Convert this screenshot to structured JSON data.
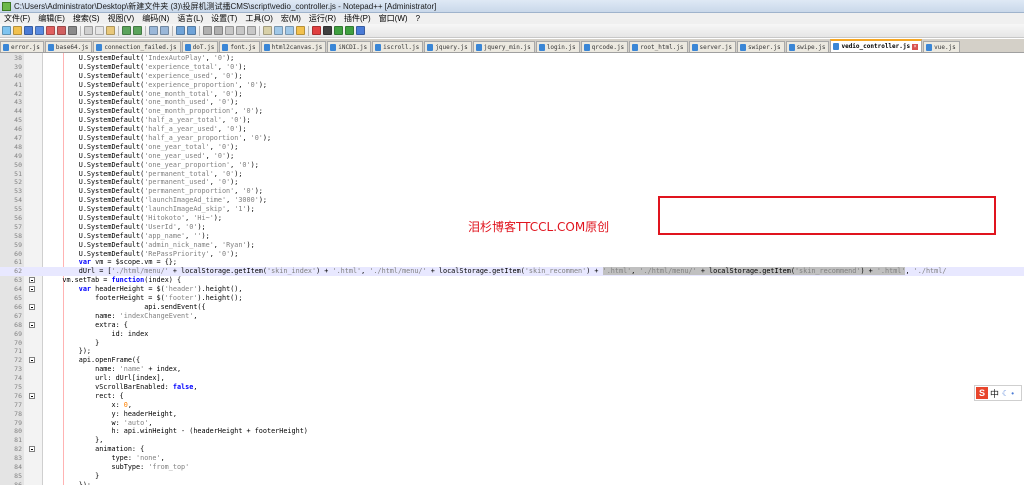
{
  "window": {
    "title": "C:\\Users\\Administrator\\Desktop\\新建文件夹 (3)\\投屏机测试播CMS\\script\\vedio_controller.js - Notepad++ [Administrator]"
  },
  "menu": [
    "文件(F)",
    "编辑(E)",
    "搜索(S)",
    "视图(V)",
    "编码(N)",
    "语言(L)",
    "设置(T)",
    "工具(O)",
    "宏(M)",
    "运行(R)",
    "插件(P)",
    "窗口(W)",
    "?"
  ],
  "tabs": [
    {
      "label": "error.js"
    },
    {
      "label": "base64.js"
    },
    {
      "label": "connection_failed.js"
    },
    {
      "label": "doT.js"
    },
    {
      "label": "font.js"
    },
    {
      "label": "html2canvas.js"
    },
    {
      "label": "iNCDI.js"
    },
    {
      "label": "iscroll.js"
    },
    {
      "label": "jquery.js"
    },
    {
      "label": "jquery_min.js"
    },
    {
      "label": "login.js"
    },
    {
      "label": "qrcode.js"
    },
    {
      "label": "root_html.js"
    },
    {
      "label": "server.js"
    },
    {
      "label": "swiper.js"
    },
    {
      "label": "swipe.js"
    },
    {
      "label": "vedio_controller.js",
      "active": true
    },
    {
      "label": "vue.js"
    }
  ],
  "watermark": "泪杉博客TTCCL.COM原创",
  "ime": {
    "logo": "S",
    "mode": "中",
    "moon": "☾",
    "dot": "•"
  },
  "colors": {
    "keyword": "#0000ff",
    "string": "#808080",
    "number": "#ff8000",
    "annotation": "#e0141e",
    "current_line": "#e8e8ff"
  },
  "code_lines": [
    {
      "n": 38,
      "html": "        U.SystemDefault(<span class=\"str\">'IndexAutoPlay'</span>, <span class=\"str\">'0'</span>);"
    },
    {
      "n": 39,
      "html": "        U.SystemDefault(<span class=\"str\">'experience_total'</span>, <span class=\"str\">'0'</span>);"
    },
    {
      "n": 40,
      "html": "        U.SystemDefault(<span class=\"str\">'experience_used'</span>, <span class=\"str\">'0'</span>);"
    },
    {
      "n": 41,
      "html": "        U.SystemDefault(<span class=\"str\">'experience_proportion'</span>, <span class=\"str\">'0'</span>);"
    },
    {
      "n": 42,
      "html": "        U.SystemDefault(<span class=\"str\">'one_month_total'</span>, <span class=\"str\">'0'</span>);"
    },
    {
      "n": 43,
      "html": "        U.SystemDefault(<span class=\"str\">'one_month_used'</span>, <span class=\"str\">'0'</span>);"
    },
    {
      "n": 44,
      "html": "        U.SystemDefault(<span class=\"str\">'one_month_proportion'</span>, <span class=\"str\">'0'</span>);"
    },
    {
      "n": 45,
      "html": "        U.SystemDefault(<span class=\"str\">'half_a_year_total'</span>, <span class=\"str\">'0'</span>);"
    },
    {
      "n": 46,
      "html": "        U.SystemDefault(<span class=\"str\">'half_a_year_used'</span>, <span class=\"str\">'0'</span>);"
    },
    {
      "n": 47,
      "html": "        U.SystemDefault(<span class=\"str\">'half_a_year_proportion'</span>, <span class=\"str\">'0'</span>);"
    },
    {
      "n": 48,
      "html": "        U.SystemDefault(<span class=\"str\">'one_year_total'</span>, <span class=\"str\">'0'</span>);"
    },
    {
      "n": 49,
      "html": "        U.SystemDefault(<span class=\"str\">'one_year_used'</span>, <span class=\"str\">'0'</span>);"
    },
    {
      "n": 50,
      "html": "        U.SystemDefault(<span class=\"str\">'one_year_proportion'</span>, <span class=\"str\">'0'</span>);"
    },
    {
      "n": 51,
      "html": "        U.SystemDefault(<span class=\"str\">'permanent_total'</span>, <span class=\"str\">'0'</span>);"
    },
    {
      "n": 52,
      "html": "        U.SystemDefault(<span class=\"str\">'permanent_used'</span>, <span class=\"str\">'0'</span>);"
    },
    {
      "n": 53,
      "html": "        U.SystemDefault(<span class=\"str\">'permanent_proportion'</span>, <span class=\"str\">'0'</span>);"
    },
    {
      "n": 54,
      "html": "        U.SystemDefault(<span class=\"str\">'launchImageAd_time'</span>, <span class=\"str\">'3000'</span>);"
    },
    {
      "n": 55,
      "html": "        U.SystemDefault(<span class=\"str\">'launchImageAd_skip'</span>, <span class=\"str\">'1'</span>);"
    },
    {
      "n": 56,
      "html": "        U.SystemDefault(<span class=\"str\">'Hitokoto'</span>, <span class=\"str\">'Hi~'</span>);"
    },
    {
      "n": 57,
      "html": "        U.SystemDefault(<span class=\"str\">'UserId'</span>, <span class=\"str\">'0'</span>);"
    },
    {
      "n": 58,
      "html": "        U.SystemDefault(<span class=\"str\">'app_name'</span>, <span class=\"str\">''</span>);"
    },
    {
      "n": 59,
      "html": "        U.SystemDefault(<span class=\"str\">'admin_nick_name'</span>, <span class=\"str\">'Ryan'</span>);"
    },
    {
      "n": 60,
      "html": "        U.SystemDefault(<span class=\"str\">'RePassPriority'</span>, <span class=\"str\">'0'</span>);"
    },
    {
      "n": 61,
      "html": "        <span class=\"kw\">var</span> vm = $scope.vm = {};"
    },
    {
      "n": 62,
      "current": true,
      "html": "        dUrl = [<span class=\"str\">'./html/menu/'</span> + localStorage.getItem(<span class=\"str\">'skin_index'</span>) + <span class=\"str\">'.html'</span>, <span class=\"str\">'./html/menu/'</span> + localStorage.getItem(<span class=\"str\">'skin_recommen'</span>) + <span class=\"hl\"><span class=\"str\">'.html'</span>, <span class=\"str\">'./html/menu/'</span> + localStorage.getItem(<span class=\"str\">'skin_recommend'</span>) + <span class=\"str\">'.html'</span></span>, <span class=\"str\">'./html/</span>"
    },
    {
      "n": 63,
      "fold": true,
      "html": "    vm.setTab = <span class=\"kw\">function</span>(index) {"
    },
    {
      "n": 64,
      "fold": true,
      "html": "        <span class=\"kw\">var</span> headerHeight = $(<span class=\"str\">'header'</span>).height(),"
    },
    {
      "n": 65,
      "html": "            footerHeight = $(<span class=\"str\">'footer'</span>).height();"
    },
    {
      "n": 66,
      "fold": true,
      "html": "                        api.sendEvent({"
    },
    {
      "n": 67,
      "html": "            name: <span class=\"str\">'indexChangeEvent'</span>,"
    },
    {
      "n": 68,
      "fold": true,
      "html": "            extra: {"
    },
    {
      "n": 69,
      "html": "                id: index"
    },
    {
      "n": 70,
      "html": "            }"
    },
    {
      "n": 71,
      "html": "        });"
    },
    {
      "n": 72,
      "fold": true,
      "html": "        api.openFrame({"
    },
    {
      "n": 73,
      "html": "            name: <span class=\"str\">'name'</span> + index,"
    },
    {
      "n": 74,
      "html": "            url: dUrl[index],"
    },
    {
      "n": 75,
      "html": "            vScrollBarEnabled: <span class=\"kw\">false</span>,"
    },
    {
      "n": 76,
      "fold": true,
      "html": "            rect: {"
    },
    {
      "n": 77,
      "html": "                x: <span class=\"num\">0</span>,"
    },
    {
      "n": 78,
      "html": "                y: headerHeight,"
    },
    {
      "n": 79,
      "html": "                w: <span class=\"str\">'auto'</span>,"
    },
    {
      "n": 80,
      "html": "                h: api.winHeight - (headerHeight + footerHeight)"
    },
    {
      "n": 81,
      "html": "            },"
    },
    {
      "n": 82,
      "fold": true,
      "html": "            animation: {"
    },
    {
      "n": 83,
      "html": "                type: <span class=\"str\">'none'</span>,"
    },
    {
      "n": 84,
      "html": "                subType: <span class=\"str\">'from_top'</span>"
    },
    {
      "n": 85,
      "html": "            }"
    },
    {
      "n": 86,
      "html": "        });"
    }
  ]
}
